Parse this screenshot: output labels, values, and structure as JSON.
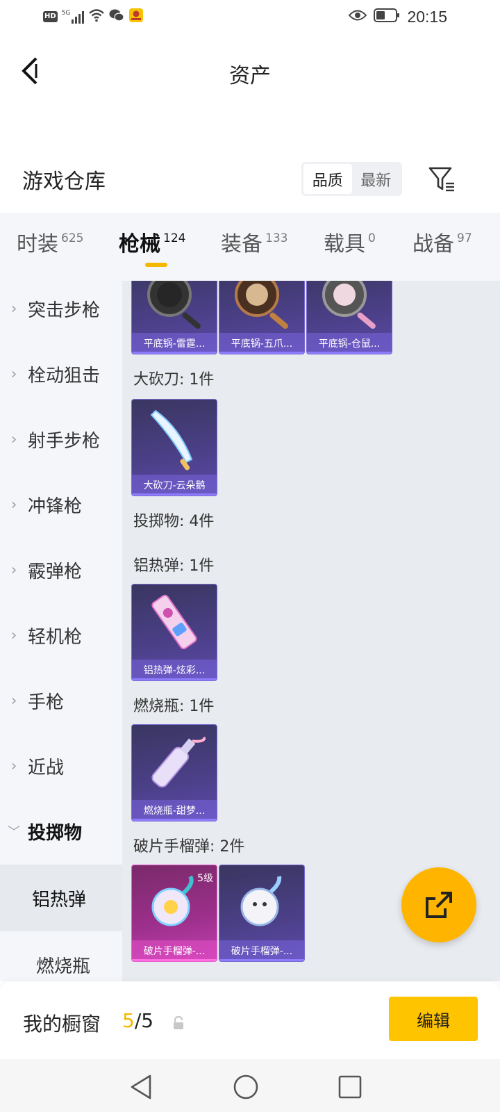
{
  "status_bar": {
    "hd_label": "HD",
    "signal_label": "5G",
    "time": "20:15",
    "icons": [
      "hd-icon",
      "signal-icon",
      "wifi-icon",
      "wechat-icon",
      "app-notification-icon",
      "eye-icon",
      "battery-icon"
    ]
  },
  "nav": {
    "title": "资产",
    "back_icon": "back-icon"
  },
  "section": {
    "title": "游戏仓库",
    "sort_options": [
      "品质",
      "最新"
    ],
    "sort_selected": "品质",
    "filter_icon": "filter-icon"
  },
  "tabs": [
    {
      "label": "时装",
      "count": "625"
    },
    {
      "label": "枪械",
      "count": "124"
    },
    {
      "label": "装备",
      "count": "133"
    },
    {
      "label": "载具",
      "count": "0"
    },
    {
      "label": "战备",
      "count": "97"
    }
  ],
  "active_tab": "枪械",
  "sidebar": {
    "categories": [
      "突击步枪",
      "栓动狙击",
      "射手步枪",
      "冲锋枪",
      "霰弹枪",
      "轻机枪",
      "手枪",
      "近战",
      "投掷物"
    ],
    "expanded": "投掷物",
    "subcategories": [
      "铝热弹",
      "燃烧瓶"
    ],
    "selected_sub": "铝热弹"
  },
  "content": {
    "pan_cards": [
      "平底锅-雷霆...",
      "平底锅-五爪...",
      "平底锅-仓鼠..."
    ],
    "groups": {
      "machete_label": "大砍刀: 1件",
      "machete_cards": [
        "大砍刀-云朵鹅"
      ],
      "throwables_label": "投掷物: 4件",
      "thermite_label": "铝热弹: 1件",
      "thermite_cards": [
        "铝热弹-炫彩..."
      ],
      "molotov_label": "燃烧瓶: 1件",
      "molotov_cards": [
        "燃烧瓶-甜梦..."
      ],
      "frag_label": "破片手榴弹: 2件",
      "frag_cards": [
        "破片手榴弹-...",
        "破片手榴弹-..."
      ],
      "frag_badge": "5级"
    }
  },
  "fab": {
    "icon": "share-icon"
  },
  "bottom_bar": {
    "label": "我的橱窗",
    "current": "5",
    "separator": "/",
    "total": "5",
    "edit_label": "编辑"
  },
  "colors": {
    "accent": "#f5b800",
    "fab": "#ffb400",
    "edit_button": "#ffc400",
    "card_purple": "#4a3f86",
    "card_pink": "#9b2f8a"
  }
}
